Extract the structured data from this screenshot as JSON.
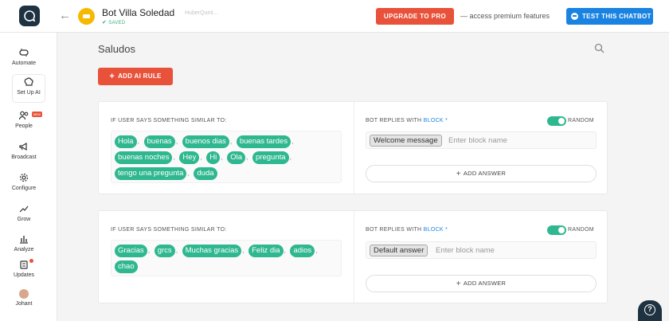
{
  "header": {
    "bot_name": "Bot Villa Soledad",
    "saved_label": "SAVED",
    "faint_text": "HuberQuinl...",
    "upgrade_label": "UPGRADE TO PRO",
    "premium_text": "— access premium features",
    "test_label": "TEST THIS CHATBOT"
  },
  "sidebar": {
    "items": [
      {
        "label": "Automate",
        "icon": "automate-icon"
      },
      {
        "label": "Set Up AI",
        "icon": "brain-icon"
      },
      {
        "label": "People",
        "icon": "people-icon",
        "badge": "NEW"
      },
      {
        "label": "Broadcast",
        "icon": "megaphone-icon"
      },
      {
        "label": "Configure",
        "icon": "gear-icon"
      },
      {
        "label": "Grow",
        "icon": "grow-icon"
      },
      {
        "label": "Analyze",
        "icon": "chart-icon"
      },
      {
        "label": "Updates",
        "icon": "updates-icon"
      },
      {
        "label": "Johant",
        "icon": "user-avatar"
      }
    ]
  },
  "main": {
    "title": "Saludos",
    "add_rule_label": "ADD AI RULE"
  },
  "rules": [
    {
      "user_says_label": "IF USER SAYS SOMETHING SIMILAR TO:",
      "phrases": [
        "Hola",
        "buenas",
        "buenos dias",
        "buenas tardes",
        "buenas noches",
        "Hey",
        "Hi",
        "Ola",
        "pregunta",
        "tengo una pregunta",
        "duda"
      ],
      "bot_replies_label": "BOT REPLIES WITH",
      "block_word": "BLOCK",
      "random_label": "RANDOM",
      "block_chip": "Welcome message",
      "block_placeholder": "Enter block name",
      "add_answer_label": "ADD ANSWER"
    },
    {
      "user_says_label": "IF USER SAYS SOMETHING SIMILAR TO:",
      "phrases": [
        "Gracias",
        "grcs",
        "Muchas gracias",
        "Feliz dia",
        "adios",
        "chao"
      ],
      "bot_replies_label": "BOT REPLIES WITH",
      "block_word": "BLOCK",
      "random_label": "RANDOM",
      "block_chip": "Default answer",
      "block_placeholder": "Enter block name",
      "add_answer_label": "ADD ANSWER"
    }
  ],
  "colors": {
    "accent_red": "#e9523a",
    "accent_blue": "#1a83e2",
    "chip_green": "#2fb88f",
    "dark_navy": "#1f3242"
  }
}
